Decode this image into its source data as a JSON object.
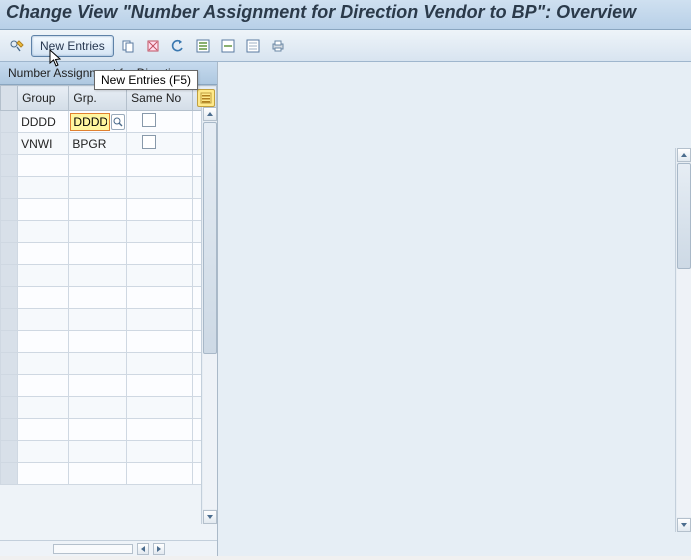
{
  "title": "Change View \"Number Assignment for Direction  Vendor to BP\": Overview",
  "toolbar": {
    "new_entries": "New Entries",
    "tooltip": "New Entries  (F5)"
  },
  "panel": {
    "header": "Number Assignment for Direction..."
  },
  "columns": {
    "group": "Group",
    "grp": "Grp.",
    "same_no": "Same No"
  },
  "rows": [
    {
      "group": "DDDD",
      "grp": "DDDD",
      "same_no": false,
      "editing": true
    },
    {
      "group": "VNWI",
      "grp": "BPGR",
      "same_no": false,
      "editing": false
    }
  ],
  "empty_rows": 15
}
